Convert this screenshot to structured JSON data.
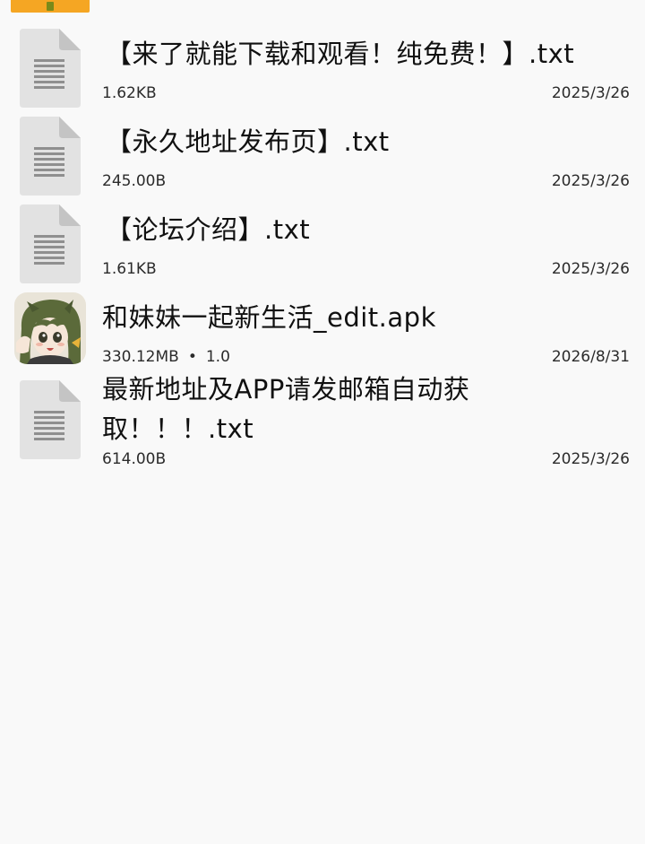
{
  "files": [
    {
      "name": "【来了就能下载和观看！纯免费！】.txt",
      "size": "1.62KB",
      "date": "2025/3/26",
      "icon": "text-file-icon"
    },
    {
      "name": "【永久地址发布页】.txt",
      "size": "245.00B",
      "date": "2025/3/26",
      "icon": "text-file-icon"
    },
    {
      "name": "【论坛介绍】.txt",
      "size": "1.61KB",
      "date": "2025/3/26",
      "icon": "text-file-icon"
    },
    {
      "name": "和妹妹一起新生活_edit.apk",
      "size": "330.12MB",
      "version": "1.0",
      "separator": "•",
      "date": "2026/8/31",
      "icon": "app-icon"
    },
    {
      "name": "最新地址及APP请发邮箱自动获取！！！.txt",
      "size": "614.00B",
      "date": "2025/3/26",
      "icon": "text-file-icon"
    }
  ],
  "colors": {
    "background": "#f9f9f9",
    "folder_accent": "#f5a623",
    "file_icon_body": "#e2e2e2",
    "file_icon_fold": "#c4c4c4",
    "file_icon_lines": "#8f8f8f"
  }
}
